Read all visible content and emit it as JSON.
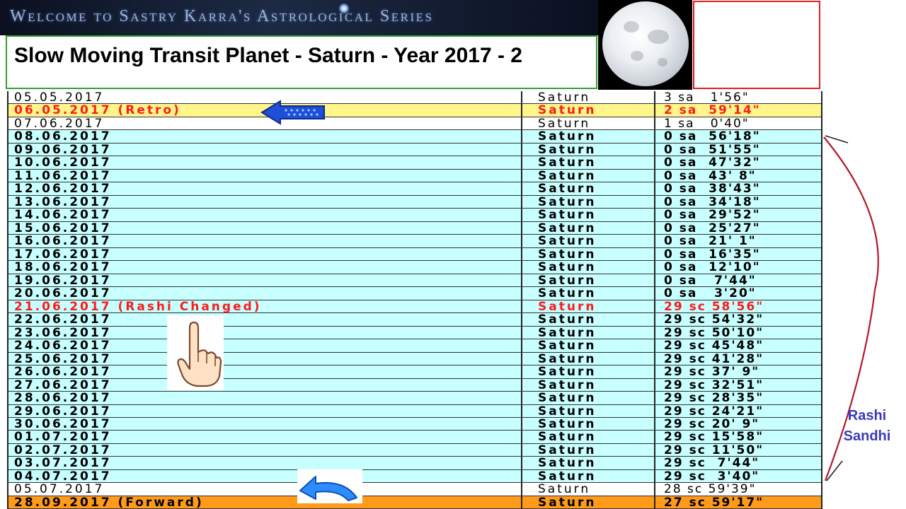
{
  "banner": {
    "text": "Welcome to Sastry Karra's Astrological Series"
  },
  "title": {
    "text": "Slow Moving Transit Planet - Saturn - Year 2017 - 2"
  },
  "table": {
    "rows": [
      {
        "date": "05.05.2017",
        "planet": "Saturn",
        "position": "3 sa   1'56\"",
        "style": "white"
      },
      {
        "date": "06.05.2017 (Retro)",
        "planet": "Saturn",
        "position": "2 sa  59'14\"",
        "style": "yellow"
      },
      {
        "date": "07.06.2017",
        "planet": "Saturn",
        "position": "1 sa   0'40\"",
        "style": "white"
      },
      {
        "date": "08.06.2017",
        "planet": "Saturn",
        "position": "0 sa  56'18\"",
        "style": "normal"
      },
      {
        "date": "09.06.2017",
        "planet": "Saturn",
        "position": "0 sa  51'55\"",
        "style": "normal"
      },
      {
        "date": "10.06.2017",
        "planet": "Saturn",
        "position": "0 sa  47'32\"",
        "style": "normal"
      },
      {
        "date": "11.06.2017",
        "planet": "Saturn",
        "position": "0 sa  43' 8\"",
        "style": "normal"
      },
      {
        "date": "12.06.2017",
        "planet": "Saturn",
        "position": "0 sa  38'43\"",
        "style": "normal"
      },
      {
        "date": "13.06.2017",
        "planet": "Saturn",
        "position": "0 sa  34'18\"",
        "style": "normal"
      },
      {
        "date": "14.06.2017",
        "planet": "Saturn",
        "position": "0 sa  29'52\"",
        "style": "normal"
      },
      {
        "date": "15.06.2017",
        "planet": "Saturn",
        "position": "0 sa  25'27\"",
        "style": "normal"
      },
      {
        "date": "16.06.2017",
        "planet": "Saturn",
        "position": "0 sa  21' 1\"",
        "style": "normal"
      },
      {
        "date": "17.06.2017",
        "planet": "Saturn",
        "position": "0 sa  16'35\"",
        "style": "normal"
      },
      {
        "date": "18.06.2017",
        "planet": "Saturn",
        "position": "0 sa  12'10\"",
        "style": "normal"
      },
      {
        "date": "19.06.2017",
        "planet": "Saturn",
        "position": "0 sa   7'44\"",
        "style": "normal"
      },
      {
        "date": "20.06.2017",
        "planet": "Saturn",
        "position": "0 sa   3'20\"",
        "style": "normal"
      },
      {
        "date": "21.06.2017 (Rashi Changed)",
        "planet": "Saturn",
        "position": "29 sc 58'56\"",
        "style": "highlight"
      },
      {
        "date": "22.06.2017",
        "planet": "Saturn",
        "position": "29 sc 54'32\"",
        "style": "normal"
      },
      {
        "date": "23.06.2017",
        "planet": "Saturn",
        "position": "29 sc 50'10\"",
        "style": "normal"
      },
      {
        "date": "24.06.2017",
        "planet": "Saturn",
        "position": "29 sc 45'48\"",
        "style": "normal"
      },
      {
        "date": "25.06.2017",
        "planet": "Saturn",
        "position": "29 sc 41'28\"",
        "style": "normal"
      },
      {
        "date": "26.06.2017",
        "planet": "Saturn",
        "position": "29 sc 37' 9\"",
        "style": "normal"
      },
      {
        "date": "27.06.2017",
        "planet": "Saturn",
        "position": "29 sc 32'51\"",
        "style": "normal"
      },
      {
        "date": "28.06.2017",
        "planet": "Saturn",
        "position": "29 sc 28'35\"",
        "style": "normal"
      },
      {
        "date": "29.06.2017",
        "planet": "Saturn",
        "position": "29 sc 24'21\"",
        "style": "normal"
      },
      {
        "date": "30.06.2017",
        "planet": "Saturn",
        "position": "29 sc 20' 9\"",
        "style": "normal"
      },
      {
        "date": "01.07.2017",
        "planet": "Saturn",
        "position": "29 sc 15'58\"",
        "style": "normal"
      },
      {
        "date": "02.07.2017",
        "planet": "Saturn",
        "position": "29 sc 11'50\"",
        "style": "normal"
      },
      {
        "date": "03.07.2017",
        "planet": "Saturn",
        "position": "29 sc  7'44\"",
        "style": "normal"
      },
      {
        "date": "04.07.2017",
        "planet": "Saturn",
        "position": "29 sc  3'40\"",
        "style": "normal"
      },
      {
        "date": "05.07.2017",
        "planet": "Saturn",
        "position": "28 sc 59'39\"",
        "style": "white"
      },
      {
        "date": "28.09.2017 (Forward)",
        "planet": "Saturn",
        "position": "27 sc 59'17\"",
        "style": "orange"
      }
    ]
  },
  "annotation": {
    "line1": "Rashi",
    "line2": "Sandhi"
  },
  "icons": {
    "retro_arrow": "blue-left-arrow-icon",
    "hand": "pointing-hand-icon",
    "curved_arrow": "curved-return-arrow-icon",
    "moon": "full-moon-image"
  },
  "colors": {
    "row_normal": "#c8ffff",
    "row_retro": "#fff58a",
    "row_forward": "#ff9a1a",
    "highlight_text": "#ff1a1a",
    "bracket": "#b0182a",
    "annotation_text": "#3b3bb8"
  }
}
